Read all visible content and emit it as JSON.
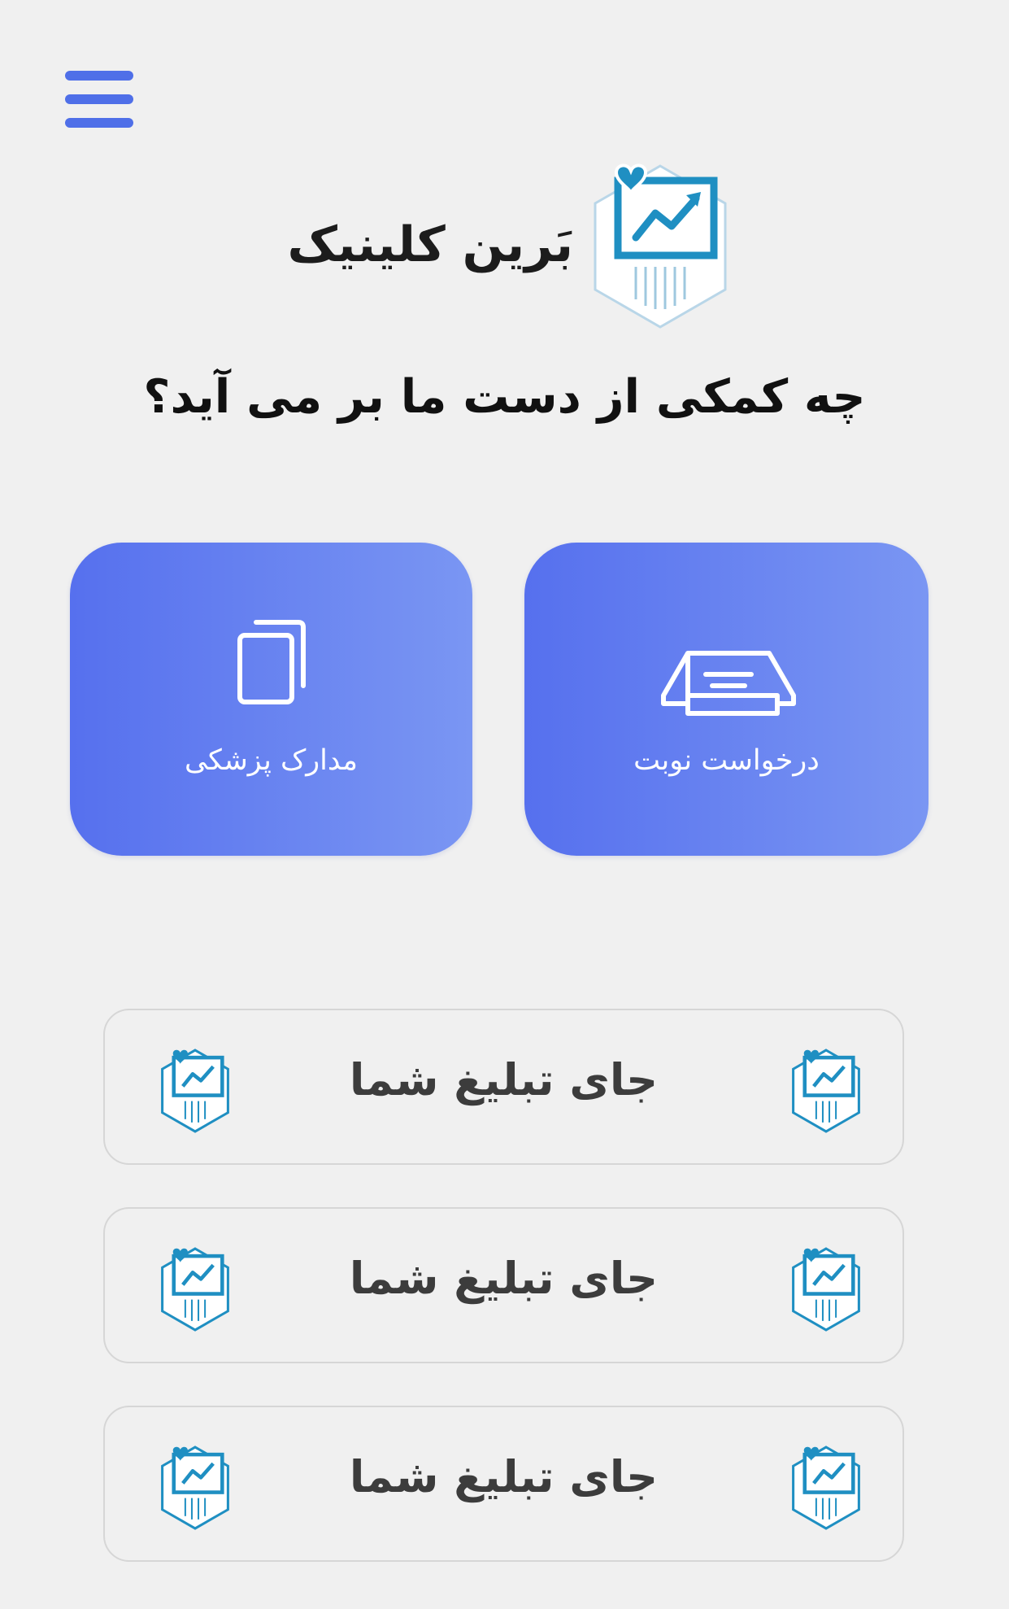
{
  "header": {
    "menu_icon": "hamburger-menu-icon",
    "brand_name": "بَرین کلینیک",
    "logo_icon": "clinic-chart-heart-logo"
  },
  "headline": "چه کمکی از دست ما بر می آید؟",
  "tiles": [
    {
      "label": "درخواست نوبت",
      "icon": "ticket-icon"
    },
    {
      "label": "مدارک پزشکی",
      "icon": "documents-icon"
    }
  ],
  "ads": [
    {
      "text": "جای تبلیغ شما"
    },
    {
      "text": "جای تبلیغ شما"
    },
    {
      "text": "جای تبلیغ شما"
    }
  ],
  "colors": {
    "accent": "#4f6fe8",
    "tile_gradient_start": "#5670ee",
    "tile_gradient_end": "#7a96f3",
    "logo_blue": "#1f8fc2",
    "background": "#f0f0f0"
  }
}
